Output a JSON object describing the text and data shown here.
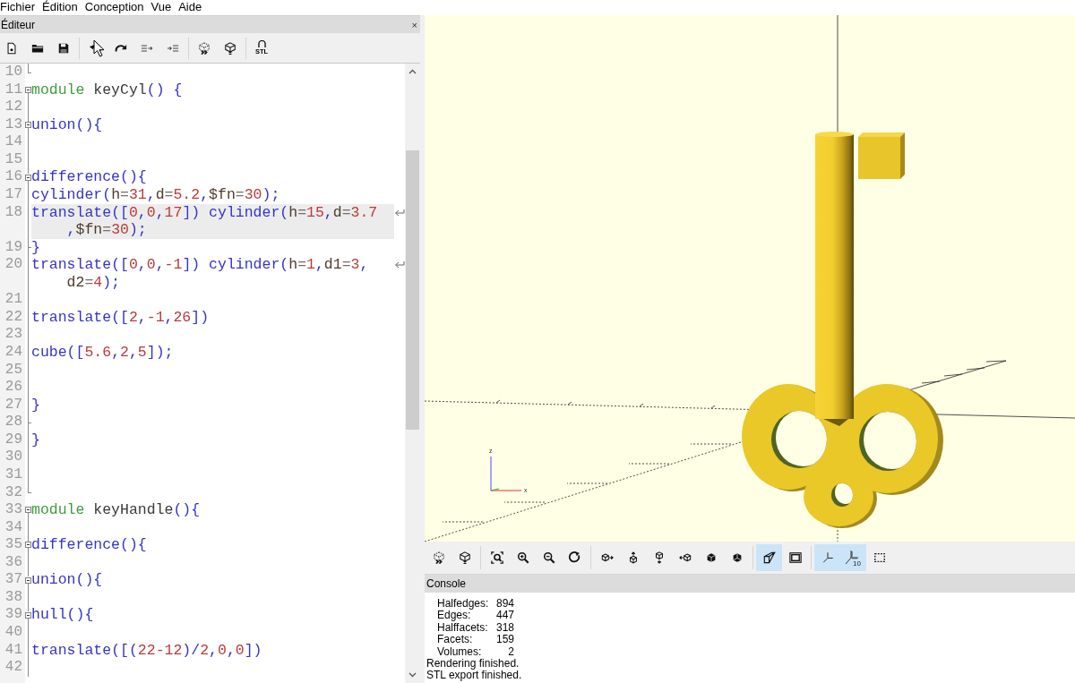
{
  "menu_bar": [
    "Fichier",
    "Édition",
    "Conception",
    "Vue",
    "Aide"
  ],
  "editor": {
    "title": "Éditeur",
    "close": "×",
    "toolbar": {
      "groups": [
        {
          "buttons": [
            {
              "kind": "new",
              "hovered": false
            },
            {
              "kind": "open",
              "hovered": false
            },
            {
              "kind": "save",
              "hovered": false
            }
          ]
        },
        {
          "buttons": [
            {
              "kind": "undo",
              "hovered": true
            },
            {
              "kind": "redo",
              "hovered": false
            },
            {
              "kind": "unindent",
              "hovered": false
            },
            {
              "kind": "indent",
              "hovered": false
            }
          ]
        },
        {
          "buttons": [
            {
              "kind": "preview",
              "hovered": false
            },
            {
              "kind": "render",
              "hovered": false
            }
          ]
        },
        {
          "buttons": [
            {
              "kind": "export",
              "label": "STL",
              "hovered": false
            }
          ]
        }
      ]
    },
    "lines": [
      {
        "number": "10",
        "kind": "end",
        "current": false
      },
      {
        "number": "11",
        "kind": "start",
        "current": false,
        "tokens": [
          {
            "kind": "keyword",
            "text": "module "
          },
          {
            "kind": "name",
            "text": "keyCyl"
          },
          {
            "kind": "punct",
            "text": "() {"
          }
        ]
      },
      {
        "number": "12",
        "kind": "body",
        "current": false
      },
      {
        "number": "13",
        "kind": "nested",
        "current": false,
        "tokens": [
          {
            "kind": "call",
            "text": "union"
          },
          {
            "kind": "punct",
            "text": "(){"
          }
        ]
      },
      {
        "number": "14",
        "kind": "body",
        "current": false
      },
      {
        "number": "15",
        "kind": "body",
        "current": false
      },
      {
        "number": "16",
        "kind": "nested",
        "current": false,
        "tokens": [
          {
            "kind": "call",
            "text": "difference"
          },
          {
            "kind": "punct",
            "text": "(){"
          }
        ]
      },
      {
        "number": "17",
        "kind": "body",
        "current": false,
        "tokens": [
          {
            "kind": "call",
            "text": "cylinder"
          },
          {
            "kind": "punct",
            "text": "("
          },
          {
            "kind": "param",
            "text": "h"
          },
          {
            "kind": "operator",
            "text": "="
          },
          {
            "kind": "number",
            "text": "31"
          },
          {
            "kind": "punct",
            "text": ","
          },
          {
            "kind": "param",
            "text": "d"
          },
          {
            "kind": "operator",
            "text": "="
          },
          {
            "kind": "number",
            "text": "5.2"
          },
          {
            "kind": "punct",
            "text": ","
          },
          {
            "kind": "param",
            "text": "$fn"
          },
          {
            "kind": "operator",
            "text": "="
          },
          {
            "kind": "number",
            "text": "30"
          },
          {
            "kind": "punct",
            "text": ");"
          }
        ]
      },
      {
        "number": "18",
        "kind": "body",
        "current": true,
        "tokens": [
          {
            "kind": "call",
            "text": "translate"
          },
          {
            "kind": "punct",
            "text": "(["
          },
          {
            "kind": "number",
            "text": "0"
          },
          {
            "kind": "punct",
            "text": ","
          },
          {
            "kind": "number",
            "text": "0"
          },
          {
            "kind": "punct",
            "text": ","
          },
          {
            "kind": "number",
            "text": "17"
          },
          {
            "kind": "punct",
            "text": "]) "
          },
          {
            "kind": "call",
            "text": "cylinder"
          },
          {
            "kind": "punct",
            "text": "("
          },
          {
            "kind": "param",
            "text": "h"
          },
          {
            "kind": "operator",
            "text": "="
          },
          {
            "kind": "number",
            "text": "15"
          },
          {
            "kind": "punct",
            "text": ","
          },
          {
            "kind": "param",
            "text": "d"
          },
          {
            "kind": "operator",
            "text": "="
          },
          {
            "kind": "number",
            "text": "3.7"
          },
          {
            "kind": "punct",
            "text": ","
          },
          {
            "kind": "param",
            "text": "$fn"
          },
          {
            "kind": "operator",
            "text": "="
          },
          {
            "kind": "number",
            "text": "30"
          },
          {
            "kind": "punct",
            "text": ");"
          }
        ]
      },
      {
        "number": "19",
        "kind": "branch",
        "current": false,
        "tokens": [
          {
            "kind": "punct",
            "text": "}"
          }
        ]
      },
      {
        "number": "20",
        "kind": "body",
        "current": false,
        "tokens": [
          {
            "kind": "call",
            "text": "translate"
          },
          {
            "kind": "punct",
            "text": "(["
          },
          {
            "kind": "number",
            "text": "0"
          },
          {
            "kind": "punct",
            "text": ","
          },
          {
            "kind": "number",
            "text": "0"
          },
          {
            "kind": "punct",
            "text": ","
          },
          {
            "kind": "number",
            "text": "-1"
          },
          {
            "kind": "punct",
            "text": "]) "
          },
          {
            "kind": "call",
            "text": "cylinder"
          },
          {
            "kind": "punct",
            "text": "("
          },
          {
            "kind": "param",
            "text": "h"
          },
          {
            "kind": "operator",
            "text": "="
          },
          {
            "kind": "number",
            "text": "1"
          },
          {
            "kind": "punct",
            "text": ","
          },
          {
            "kind": "param",
            "text": "d1"
          },
          {
            "kind": "operator",
            "text": "="
          },
          {
            "kind": "number",
            "text": "3"
          },
          {
            "kind": "punct",
            "text": ","
          },
          {
            "kind": "param",
            "text": "d2"
          },
          {
            "kind": "operator",
            "text": "="
          },
          {
            "kind": "number",
            "text": "4"
          },
          {
            "kind": "punct",
            "text": ");"
          }
        ]
      },
      {
        "number": "21",
        "kind": "body",
        "current": false
      },
      {
        "number": "22",
        "kind": "body",
        "current": false,
        "tokens": [
          {
            "kind": "call",
            "text": "translate"
          },
          {
            "kind": "punct",
            "text": "(["
          },
          {
            "kind": "number",
            "text": "2"
          },
          {
            "kind": "punct",
            "text": ","
          },
          {
            "kind": "number",
            "text": "-1"
          },
          {
            "kind": "punct",
            "text": ","
          },
          {
            "kind": "number",
            "text": "26"
          },
          {
            "kind": "punct",
            "text": "])"
          }
        ]
      },
      {
        "number": "23",
        "kind": "body",
        "current": false
      },
      {
        "number": "24",
        "kind": "body",
        "current": false,
        "tokens": [
          {
            "kind": "call",
            "text": "cube"
          },
          {
            "kind": "punct",
            "text": "(["
          },
          {
            "kind": "number",
            "text": "5.6"
          },
          {
            "kind": "punct",
            "text": ","
          },
          {
            "kind": "number",
            "text": "2"
          },
          {
            "kind": "punct",
            "text": ","
          },
          {
            "kind": "number",
            "text": "5"
          },
          {
            "kind": "punct",
            "text": "]);"
          }
        ]
      },
      {
        "number": "25",
        "kind": "body",
        "current": false
      },
      {
        "number": "26",
        "kind": "body",
        "current": false
      },
      {
        "number": "27",
        "kind": "body",
        "current": false,
        "tokens": [
          {
            "kind": "punct",
            "text": "}"
          }
        ]
      },
      {
        "number": "28",
        "kind": "branch",
        "current": false
      },
      {
        "number": "29",
        "kind": "body",
        "current": false,
        "tokens": [
          {
            "kind": "punct",
            "text": "}"
          }
        ]
      },
      {
        "number": "30",
        "kind": "body",
        "current": false
      },
      {
        "number": "31",
        "kind": "body",
        "current": false
      },
      {
        "number": "32",
        "kind": "end",
        "current": false
      },
      {
        "number": "33",
        "kind": "start",
        "current": false,
        "tokens": [
          {
            "kind": "keyword",
            "text": "module "
          },
          {
            "kind": "name",
            "text": "keyHandle"
          },
          {
            "kind": "punct",
            "text": "(){"
          }
        ]
      },
      {
        "number": "34",
        "kind": "body",
        "current": false
      },
      {
        "number": "35",
        "kind": "nested",
        "current": false,
        "tokens": [
          {
            "kind": "call",
            "text": "difference"
          },
          {
            "kind": "punct",
            "text": "(){"
          }
        ]
      },
      {
        "number": "36",
        "kind": "body",
        "current": false
      },
      {
        "number": "37",
        "kind": "nested",
        "current": false,
        "tokens": [
          {
            "kind": "call",
            "text": "union"
          },
          {
            "kind": "punct",
            "text": "(){"
          }
        ]
      },
      {
        "number": "38",
        "kind": "body",
        "current": false
      },
      {
        "number": "39",
        "kind": "nested",
        "current": false,
        "tokens": [
          {
            "kind": "call",
            "text": "hull"
          },
          {
            "kind": "punct",
            "text": "(){"
          }
        ]
      },
      {
        "number": "40",
        "kind": "body",
        "current": false
      },
      {
        "number": "41",
        "kind": "body",
        "current": false,
        "tokens": [
          {
            "kind": "call",
            "text": "translate"
          },
          {
            "kind": "punct",
            "text": "([("
          },
          {
            "kind": "number",
            "text": "22-12"
          },
          {
            "kind": "punct",
            "text": ")/"
          },
          {
            "kind": "number",
            "text": "2"
          },
          {
            "kind": "punct",
            "text": ","
          },
          {
            "kind": "number",
            "text": "0"
          },
          {
            "kind": "punct",
            "text": ","
          },
          {
            "kind": "number",
            "text": "0"
          },
          {
            "kind": "punct",
            "text": "])"
          }
        ]
      },
      {
        "number": "42",
        "kind": "body",
        "current": false
      }
    ]
  },
  "viewport": {
    "axis_labels": [
      "z",
      "x"
    ],
    "toolbar": {
      "groups": [
        {
          "buttons": [
            {
              "kind": "preview",
              "selected": false
            },
            {
              "kind": "render",
              "selected": false
            }
          ]
        },
        {
          "buttons": [
            {
              "kind": "viewall",
              "selected": false
            },
            {
              "kind": "zoomin",
              "selected": false
            },
            {
              "kind": "zoomout",
              "selected": false
            },
            {
              "kind": "reset",
              "selected": false
            }
          ]
        },
        {
          "buttons": [
            {
              "kind": "right",
              "selected": false
            },
            {
              "kind": "top",
              "selected": false
            },
            {
              "kind": "bottom",
              "selected": false
            },
            {
              "kind": "left",
              "selected": false
            },
            {
              "kind": "front",
              "selected": false
            },
            {
              "kind": "back",
              "selected": false
            }
          ]
        },
        {
          "buttons": [
            {
              "kind": "perspective",
              "selected": true
            },
            {
              "kind": "orthogonal",
              "selected": false
            }
          ]
        },
        {
          "buttons": [
            {
              "kind": "axes",
              "selected": true
            },
            {
              "kind": "scale",
              "label": "10",
              "selected": true
            },
            {
              "kind": "edges",
              "selected": false
            }
          ]
        }
      ]
    }
  },
  "console": {
    "title": "Console",
    "stats": [
      {
        "label": "Halfedges:",
        "value": "894"
      },
      {
        "label": "Edges:",
        "value": "447"
      },
      {
        "label": "Halffacets:",
        "value": "318"
      },
      {
        "label": "Facets:",
        "value": "159"
      },
      {
        "label": "Volumes:",
        "value": "2"
      }
    ],
    "messages": [
      "Rendering finished.",
      "STL export finished."
    ]
  }
}
